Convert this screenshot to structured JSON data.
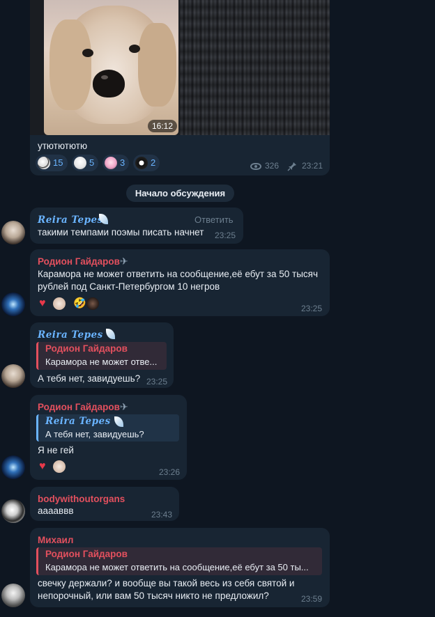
{
  "post": {
    "video_duration": "16:12",
    "caption": "утютютютю",
    "reactions": [
      {
        "icon": "rabbit-sticker-icon",
        "count": "15"
      },
      {
        "icon": "ghost-sticker-icon",
        "count": "5"
      },
      {
        "icon": "pink-cat-sticker-icon",
        "count": "3"
      },
      {
        "icon": "grinning-face-sticker-icon",
        "count": "2"
      }
    ],
    "views": "326",
    "time": "23:21"
  },
  "discussion_start": "Начало обсуждения",
  "messages": [
    {
      "author": "Reira Tepes",
      "reply_button": "Ответить",
      "text": "такими темпами поэмы писать начнет",
      "time": "23:25"
    },
    {
      "author": "Родион Гайдаров",
      "text_lines": [
        "Карамора не может ответить на сообщение,её ебут за 50 тысяч",
        "рублей под Санкт-Петербургом 10 негров"
      ],
      "time": "23:25"
    },
    {
      "author": "Reira Tepes",
      "quote_author": "Родион Гайдаров",
      "quote_text": "Карамора не может отве...",
      "text": "А тебя нет, завидуешь?",
      "time": "23:25"
    },
    {
      "author": "Родион Гайдаров",
      "quote_author": "Reira Tepes",
      "quote_text": "А тебя нет, завидуешь?",
      "text": "Я не гей",
      "time": "23:26"
    },
    {
      "author": "bodywithoutorgans",
      "text": "ааааввв",
      "time": "23:43"
    },
    {
      "author": "Михаил",
      "quote_author": "Родион Гайдаров",
      "quote_text": "Карамора не может ответить на сообщение,её ебут за 50 ты...",
      "text_lines": [
        "свечку держали? и вообще вы такой весь из себя святой и",
        "непорочный, или вам 50 тысяч никто не предложил?"
      ],
      "time": "23:59"
    }
  ],
  "colors": {
    "background": "#0e1621",
    "bubble": "#182533",
    "name_red": "#e3505e",
    "name_blue": "#6ab4ff",
    "meta": "#6d7f8f"
  }
}
